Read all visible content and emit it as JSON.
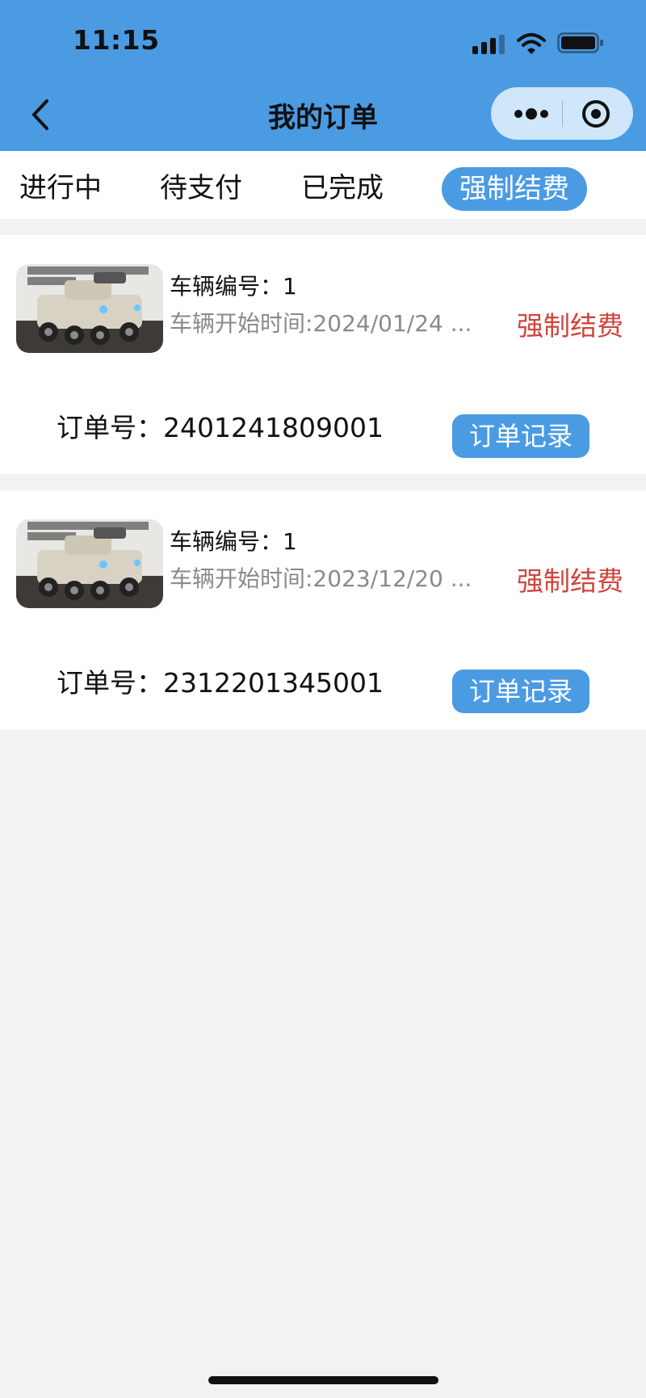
{
  "status_bar": {
    "time": "11:15"
  },
  "header": {
    "title": "我的订单"
  },
  "icons": {
    "back": "chevron-left-icon",
    "more": "more-dots-icon",
    "close": "target-circle-icon",
    "signal": "signal-bars-icon",
    "wifi": "wifi-icon",
    "battery": "battery-icon"
  },
  "tabs": [
    {
      "label": "进行中",
      "active": false
    },
    {
      "label": "待支付",
      "active": false
    },
    {
      "label": "已完成",
      "active": false
    },
    {
      "label": "强制结费",
      "active": true
    }
  ],
  "orders": [
    {
      "vehicle_label": "车辆编号：1",
      "start_time": "车辆开始时间:2024/01/24 ...",
      "status": "强制结费",
      "order_no": "订单号：2401241809001",
      "record_button": "订单记录"
    },
    {
      "vehicle_label": "车辆编号：1",
      "start_time": "车辆开始时间:2023/12/20 ...",
      "status": "强制结费",
      "order_no": "订单号：2312201345001",
      "record_button": "订单记录"
    }
  ],
  "colors": {
    "accent": "#4b9be3",
    "status_red": "#d0443e",
    "page_bg": "#f2f2f2"
  }
}
